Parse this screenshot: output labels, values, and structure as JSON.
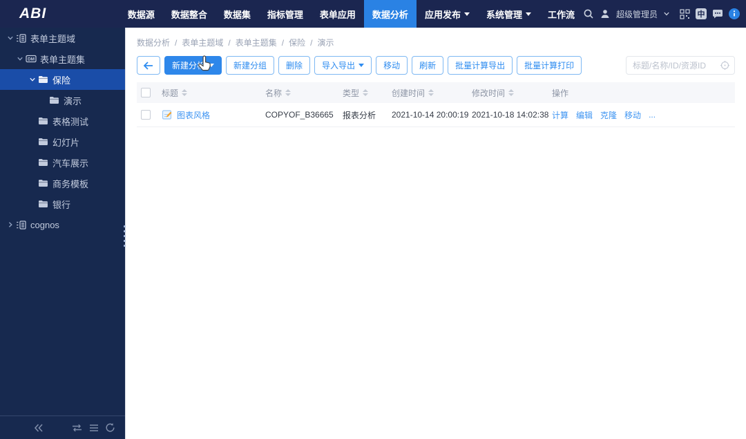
{
  "colors": {
    "accent": "#2a82e4",
    "nav_bg": "#1b2650",
    "sidebar_bg": "#17294f",
    "selected_bg": "#1a4da8",
    "link": "#3f95f2",
    "primary_button": "#2e87ea"
  },
  "nav": {
    "logo": "ABI",
    "items": [
      {
        "label": "数据源"
      },
      {
        "label": "数据整合"
      },
      {
        "label": "数据集"
      },
      {
        "label": "指标管理"
      },
      {
        "label": "表单应用"
      },
      {
        "label": "数据分析",
        "active": true
      },
      {
        "label": "应用发布",
        "dropdown": true
      },
      {
        "label": "系统管理",
        "dropdown": true
      },
      {
        "label": "工作流"
      }
    ],
    "user": {
      "name": "超级管理员"
    },
    "language_label": "中"
  },
  "sidebar": {
    "tree": [
      {
        "label": "表单主题域",
        "level": 0,
        "icon": "domain",
        "chevron": "down"
      },
      {
        "label": "表单主题集",
        "level": 1,
        "icon": "dm",
        "chevron": "down"
      },
      {
        "label": "保险",
        "level": 2,
        "icon": "folder",
        "chevron": "down",
        "selected": true
      },
      {
        "label": "演示",
        "level": 3,
        "icon": "folder",
        "chevron": null
      },
      {
        "label": "表格测试",
        "level": 2,
        "icon": "folder",
        "chevron": null
      },
      {
        "label": "幻灯片",
        "level": 2,
        "icon": "folder",
        "chevron": null
      },
      {
        "label": "汽车展示",
        "level": 2,
        "icon": "folder",
        "chevron": null
      },
      {
        "label": "商务模板",
        "level": 2,
        "icon": "folder",
        "chevron": null
      },
      {
        "label": "银行",
        "level": 2,
        "icon": "folder",
        "chevron": null
      },
      {
        "label": "cognos",
        "level": 0,
        "icon": "domain",
        "chevron": "right"
      }
    ]
  },
  "main": {
    "breadcrumb": {
      "items": [
        "数据分析",
        "表单主题域",
        "表单主题集",
        "保险",
        "演示"
      ],
      "separator": "/"
    },
    "toolbar": {
      "buttons": [
        {
          "label": "新建分析",
          "primary": true,
          "dropdown": true
        },
        {
          "label": "新建分组"
        },
        {
          "label": "删除"
        },
        {
          "label": "导入导出",
          "dropdown": true
        },
        {
          "label": "移动"
        },
        {
          "label": "刷新"
        },
        {
          "label": "批量计算导出"
        },
        {
          "label": "批量计算打印"
        }
      ]
    },
    "search": {
      "placeholder": "标题/名称/ID/资源ID"
    },
    "table": {
      "headers": [
        {
          "label": "标题",
          "sortable": true
        },
        {
          "label": "名称",
          "sortable": true
        },
        {
          "label": "类型",
          "sortable": true
        },
        {
          "label": "创建时间",
          "sortable": true
        },
        {
          "label": "修改时间",
          "sortable": true
        },
        {
          "label": "操作",
          "sortable": false
        }
      ],
      "rows": [
        {
          "title": "图表风格",
          "name": "COPYOF_B36665",
          "type": "报表分析",
          "created": "2021-10-14 20:00:19",
          "modified": "2021-10-18 14:02:38",
          "actions": [
            "计算",
            "编辑",
            "克隆",
            "移动",
            "..."
          ]
        }
      ]
    }
  }
}
